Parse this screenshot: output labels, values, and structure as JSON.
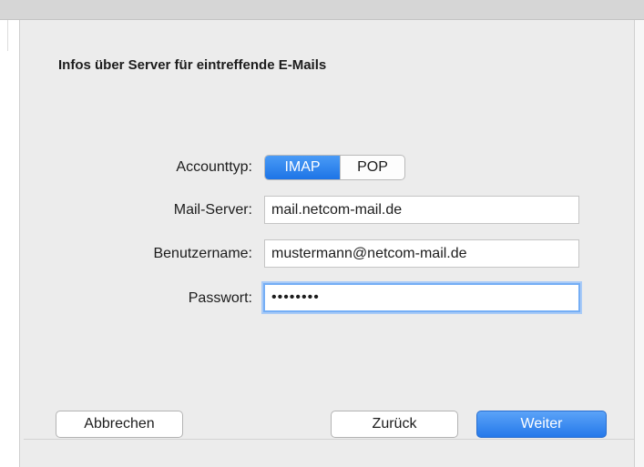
{
  "dialog": {
    "title": "Infos über Server für eintreffende E-Mails"
  },
  "form": {
    "account_type": {
      "label": "Accounttyp:",
      "options": [
        "IMAP",
        "POP"
      ],
      "selected": "IMAP"
    },
    "mail_server": {
      "label": "Mail-Server:",
      "value": "mail.netcom-mail.de"
    },
    "username": {
      "label": "Benutzername:",
      "value": "mustermann@netcom-mail.de"
    },
    "password": {
      "label": "Passwort:",
      "value": "••••••••"
    }
  },
  "buttons": {
    "cancel": "Abbrechen",
    "back": "Zurück",
    "next": "Weiter"
  },
  "colors": {
    "accent": "#2579ea",
    "focus_ring": "#75aef5"
  }
}
